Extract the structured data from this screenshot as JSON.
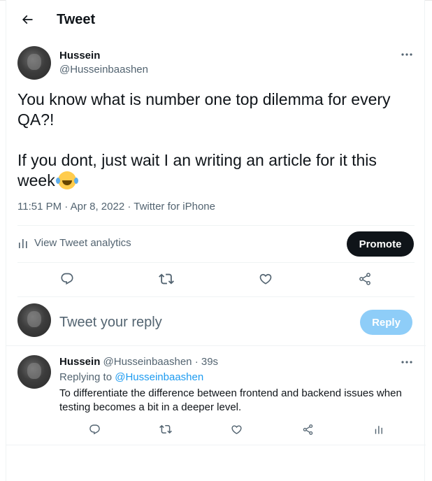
{
  "header": {
    "title": "Tweet"
  },
  "tweet": {
    "author_name": "Hussein",
    "author_handle": "@Husseinbaashen",
    "text": "You know what is number one top dilemma for every QA?!\n\nIf you dont, just wait I an writing an article for it this week",
    "emoji": "face-with-tears-of-joy",
    "time": "11:51 PM",
    "date": "Apr 8, 2022",
    "source": "Twitter for iPhone",
    "analytics_label": "View Tweet analytics",
    "promote_label": "Promote"
  },
  "compose": {
    "placeholder": "Tweet your reply",
    "reply_label": "Reply"
  },
  "reply": {
    "author_name": "Hussein",
    "author_handle": "@Husseinbaashen",
    "separator": "·",
    "time": "39s",
    "replying_prefix": "Replying to",
    "replying_handle": "@Husseinbaashen",
    "text": "To differentiate the difference between frontend and backend issues when testing becomes a bit in a deeper level."
  },
  "colors": {
    "text_primary": "#0f1419",
    "text_secondary": "#536471",
    "link": "#1d9bf0",
    "promote_bg": "#0f1419",
    "reply_disabled_bg": "#8ecdf8",
    "border": "#eff3f4"
  },
  "icons": {
    "back": "arrow-left-icon",
    "more": "more-dots-icon",
    "analytics": "bar-chart-icon",
    "reply": "comment-icon",
    "retweet": "retweet-icon",
    "like": "heart-icon",
    "share": "share-icon"
  }
}
